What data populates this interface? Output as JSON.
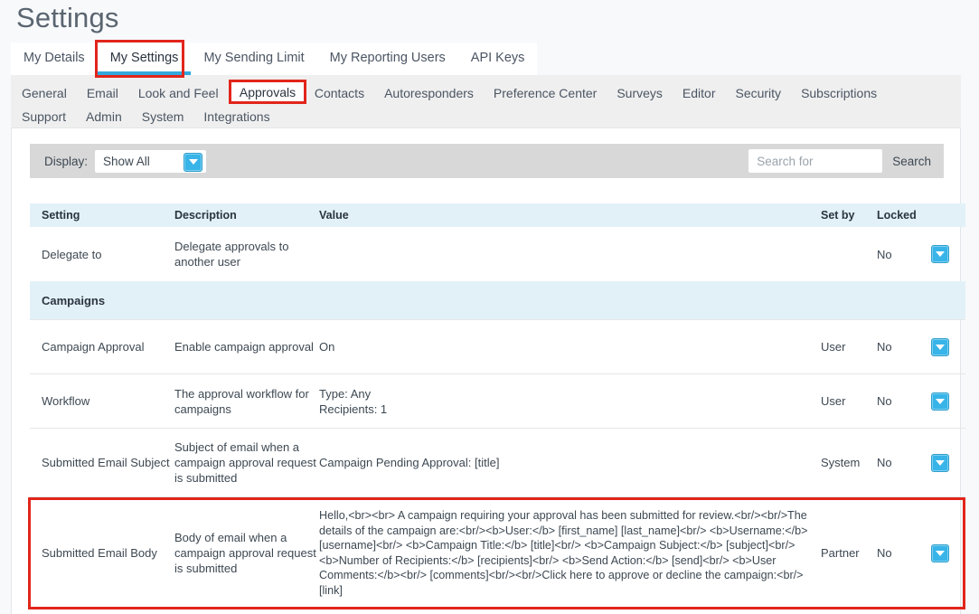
{
  "page": {
    "title": "Settings"
  },
  "tabs": [
    {
      "label": "My Details",
      "active": false
    },
    {
      "label": "My Settings",
      "active": true
    },
    {
      "label": "My Sending Limit",
      "active": false
    },
    {
      "label": "My Reporting Users",
      "active": false
    },
    {
      "label": "API Keys",
      "active": false
    }
  ],
  "subnav": [
    {
      "label": "General"
    },
    {
      "label": "Email"
    },
    {
      "label": "Look and Feel"
    },
    {
      "label": "Approvals"
    },
    {
      "label": "Contacts"
    },
    {
      "label": "Autoresponders"
    },
    {
      "label": "Preference Center"
    },
    {
      "label": "Surveys"
    },
    {
      "label": "Editor"
    },
    {
      "label": "Security"
    },
    {
      "label": "Subscriptions"
    },
    {
      "label": "Support"
    },
    {
      "label": "Admin"
    },
    {
      "label": "System"
    },
    {
      "label": "Integrations"
    }
  ],
  "subnav_selected": "Approvals",
  "toolbar": {
    "display_label": "Display:",
    "display_value": "Show All",
    "search_placeholder": "Search for",
    "search_value": "",
    "search_button": "Search"
  },
  "table": {
    "headers": {
      "setting": "Setting",
      "description": "Description",
      "value": "Value",
      "set_by": "Set by",
      "locked": "Locked"
    },
    "rows": [
      {
        "kind": "setting",
        "setting": "Delegate to",
        "description": "Delegate approvals to another user",
        "value": "",
        "set_by": "",
        "locked": "No",
        "highlighted": false
      },
      {
        "kind": "section",
        "setting": "Campaigns",
        "description": "",
        "value": "",
        "set_by": "",
        "locked": "",
        "highlighted": false
      },
      {
        "kind": "setting",
        "setting": "Campaign Approval",
        "description": "Enable campaign approval",
        "value": "On",
        "set_by": "User",
        "locked": "No",
        "highlighted": false
      },
      {
        "kind": "setting",
        "setting": "Workflow",
        "description": "The approval workflow for campaigns",
        "value": "Type: Any\nRecipients: 1",
        "set_by": "User",
        "locked": "No",
        "highlighted": false
      },
      {
        "kind": "setting",
        "setting": "Submitted Email Subject",
        "description": "Subject of email when a campaign approval request is submitted",
        "value": "Campaign Pending Approval: [title]",
        "set_by": "System",
        "locked": "No",
        "highlighted": false
      },
      {
        "kind": "setting",
        "setting": "Submitted Email Body",
        "description": "Body of email when a campaign approval request is submitted",
        "value": "Hello,<br><br> A campaign requiring your approval has been submitted for review.<br/><br/>The details of the campaign are:<br/><b>User:</b> [first_name] [last_name]<br/> <b>Username:</b> [username]<br/> <b>Campaign Title:</b> [title]<br/> <b>Campaign Subject:</b> [subject]<br/> <b>Number of Recipients:</b> [recipients]<br/> <b>Send Action:</b> [send]<br/> <b>User Comments:</b><br/> [comments]<br/><br/>Click here to approve or decline the campaign:<br/>[link]",
        "set_by": "Partner",
        "locked": "No",
        "highlighted": true
      }
    ]
  },
  "colors": {
    "accent_blue": "#38b4e8",
    "annotation_red": "#e1251b",
    "header_blue": "#e2f1f8",
    "toolbar_gray": "#d8d8d8"
  },
  "icons": {
    "row_action": "chevron-down-icon",
    "select_caret": "chevron-down-icon"
  }
}
